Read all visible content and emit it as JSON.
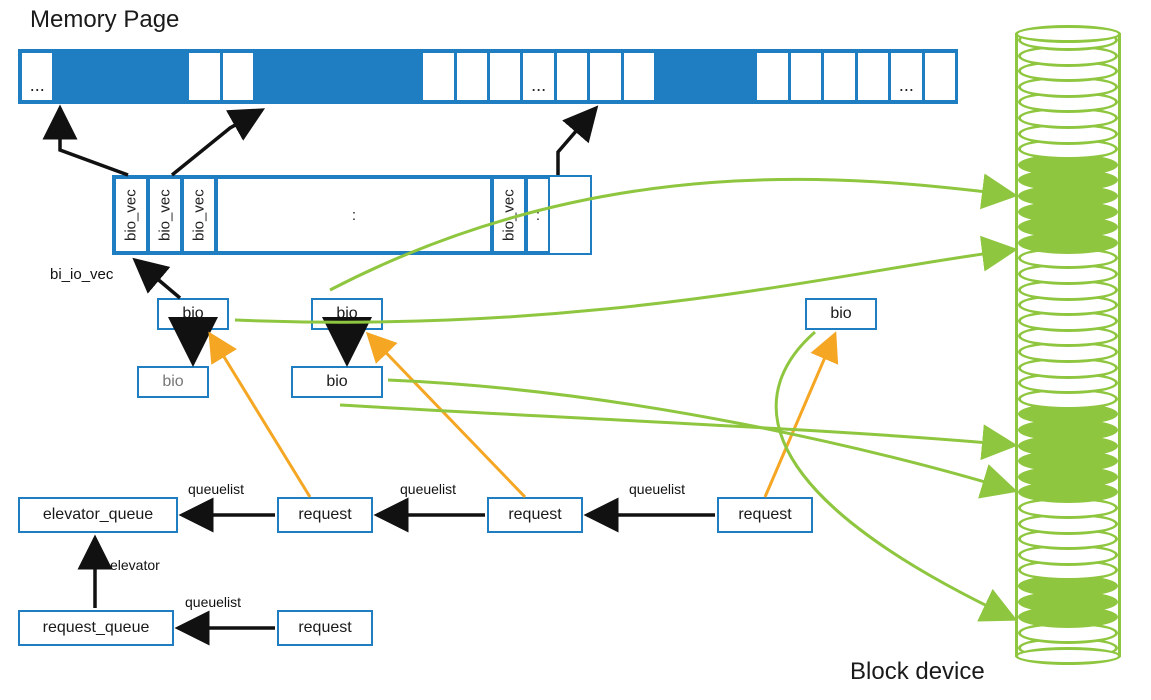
{
  "title": "Memory Page",
  "block_device_label": "Block device",
  "bi_io_vec_label": "bi_io_vec",
  "labels": {
    "queuelist": "queuelist",
    "elevator": "elevator",
    "ellipsis": "...",
    "colon": ":"
  },
  "nodes": {
    "bio_vec": "bio_vec",
    "bio": "bio",
    "request": "request",
    "elevator_queue": "elevator_queue",
    "request_queue": "request_queue"
  },
  "memory_row": {
    "cells": [
      {
        "type": "ellipsis"
      },
      {
        "type": "filled"
      },
      {
        "type": "filled"
      },
      {
        "type": "filled"
      },
      {
        "type": "filled"
      },
      {
        "type": "empty"
      },
      {
        "type": "empty"
      },
      {
        "type": "filled"
      },
      {
        "type": "filled"
      },
      {
        "type": "filled"
      },
      {
        "type": "filled"
      },
      {
        "type": "filled"
      },
      {
        "type": "empty"
      },
      {
        "type": "empty"
      },
      {
        "type": "empty"
      },
      {
        "type": "ellipsis"
      },
      {
        "type": "empty"
      },
      {
        "type": "empty"
      },
      {
        "type": "empty"
      },
      {
        "type": "filled"
      },
      {
        "type": "filled"
      },
      {
        "type": "filled"
      },
      {
        "type": "empty"
      },
      {
        "type": "empty"
      },
      {
        "type": "empty"
      },
      {
        "type": "empty"
      },
      {
        "type": "ellipsis"
      },
      {
        "type": "empty"
      }
    ]
  },
  "bio_vec_row": {
    "items": [
      "bio_vec",
      "bio_vec",
      "bio_vec",
      "spacer",
      "bio_vec",
      "end"
    ]
  },
  "block_device": {
    "filled_ranges": [
      [
        8,
        13
      ],
      [
        24,
        29
      ],
      [
        35,
        37
      ]
    ]
  }
}
